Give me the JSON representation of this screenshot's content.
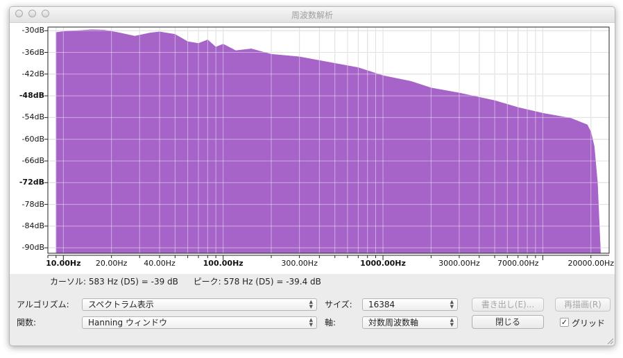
{
  "window": {
    "title": "周波数解析"
  },
  "chart_data": {
    "type": "area",
    "title": "",
    "xscale": "log",
    "yunit": "dB",
    "xlim": [
      8,
      26000
    ],
    "ylim": [
      -91.5,
      -29
    ],
    "y_ticks": [
      "-30dB",
      "-36dB",
      "-42dB",
      "-48dB",
      "-54dB",
      "-60dB",
      "-66dB",
      "-72dB",
      "-78dB",
      "-84dB",
      "-90dB"
    ],
    "y_tick_values": [
      -30,
      -36,
      -42,
      -48,
      -54,
      -60,
      -66,
      -72,
      -78,
      -84,
      -90
    ],
    "y_bold_ticks": [
      "-48dB",
      "-72dB"
    ],
    "x_ticks": [
      {
        "label": "10.00Hz",
        "value": 10,
        "bold": true
      },
      {
        "label": "20.00Hz",
        "value": 20,
        "bold": false
      },
      {
        "label": "40.00Hz",
        "value": 40,
        "bold": false
      },
      {
        "label": "100.00Hz",
        "value": 100,
        "bold": true
      },
      {
        "label": "300.00Hz",
        "value": 300,
        "bold": false
      },
      {
        "label": "1000.00Hz",
        "value": 1000,
        "bold": true
      },
      {
        "label": "3000.00Hz",
        "value": 3000,
        "bold": false
      },
      {
        "label": "7000.00Hz",
        "value": 7000,
        "bold": false
      },
      {
        "label": "20000.00Hz",
        "value": 20000,
        "bold": false
      }
    ],
    "grid": true,
    "fill_color": "#a764c8",
    "series": [
      {
        "x": [
          9,
          10,
          12,
          15,
          18,
          22,
          28,
          35,
          40,
          50,
          60,
          70,
          80,
          90,
          100,
          120,
          150,
          200,
          300,
          500,
          700,
          1000,
          1500,
          2000,
          3000,
          5000,
          7000,
          10000,
          15000,
          19000,
          20000,
          21000,
          22000,
          23000
        ],
        "y": [
          -30.5,
          -30.2,
          -30.0,
          -29.7,
          -29.8,
          -30.5,
          -31.5,
          -30.6,
          -30.3,
          -31.0,
          -33.0,
          -33.5,
          -32.5,
          -34.5,
          -33.7,
          -35.5,
          -35.0,
          -36.5,
          -37.2,
          -39.0,
          -40.2,
          -42.4,
          -44.0,
          -45.8,
          -47.2,
          -49.3,
          -51.2,
          -52.8,
          -54.2,
          -56.0,
          -58.0,
          -62.0,
          -72.0,
          -91.5
        ]
      }
    ]
  },
  "readout": {
    "cursor": "カーソル: 583 Hz (D5) = -39 dB",
    "peak": "ピーク: 578 Hz (D5) = -39.4 dB"
  },
  "controls": {
    "algorithm_label": "アルゴリズム:",
    "algorithm_value": "スペクトラム表示",
    "function_label": "関数:",
    "function_value": "Hanning ウィンドウ",
    "size_label": "サイズ:",
    "size_value": "16384",
    "axis_label": "軸:",
    "axis_value": "対数周波数軸",
    "export_label": "書き出し(E)...",
    "replot_label": "再描画(R)",
    "close_label": "閉じる",
    "grid_label": "グリッド",
    "grid_checked": true
  }
}
